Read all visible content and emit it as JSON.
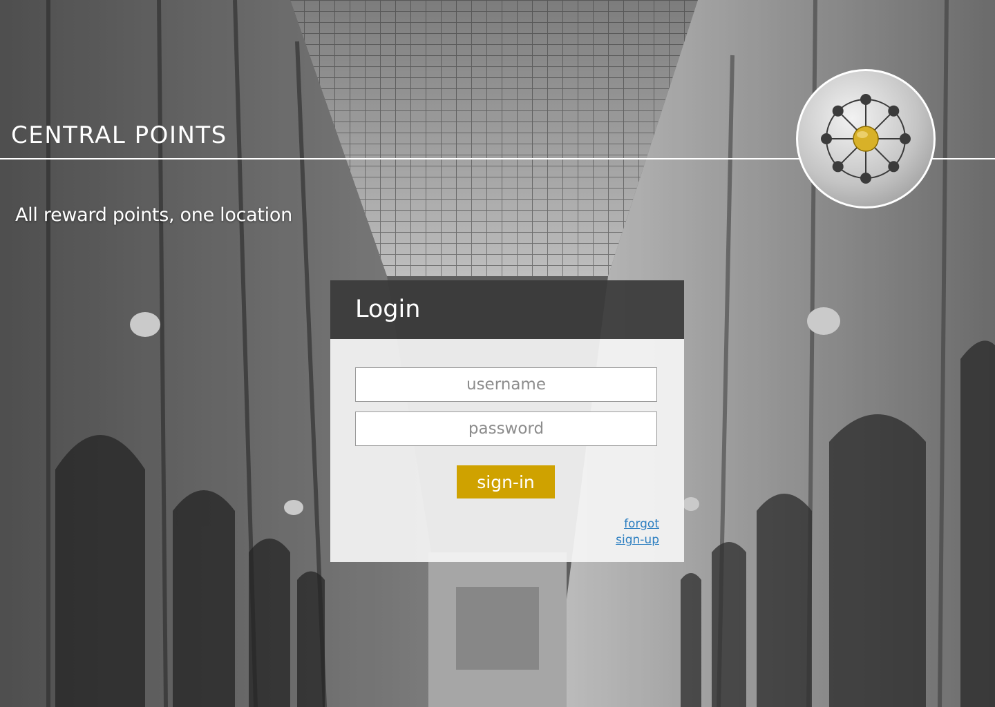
{
  "header": {
    "brand": "CENTRAL POINTS",
    "tagline": "All reward points, one location",
    "logo_icon": "network-hub-icon"
  },
  "login": {
    "title": "Login",
    "username_placeholder": "username",
    "password_placeholder": "password",
    "signin_label": "sign-in",
    "forgot_label": "forgot",
    "signup_label": "sign-up"
  },
  "colors": {
    "accent": "#cfa200",
    "link": "#2d7fc1",
    "panel_header": "#3a3a3a"
  }
}
